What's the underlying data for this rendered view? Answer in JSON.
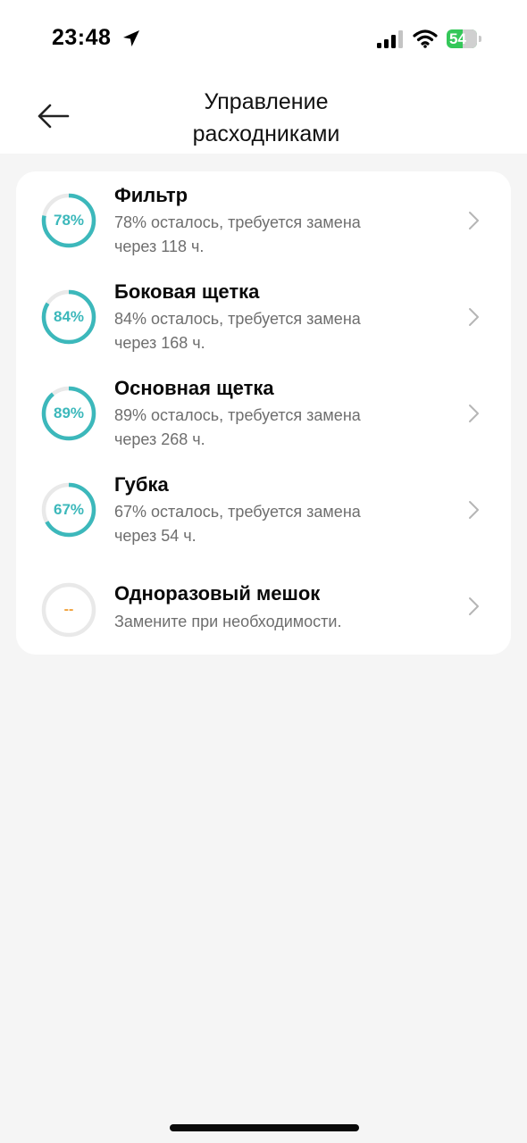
{
  "status_bar": {
    "time": "23:48",
    "battery_text": "54",
    "battery_level": 0.54,
    "location_icon": "location-arrow-icon",
    "signal_icon": "cellular-signal-icon",
    "wifi_icon": "wifi-icon"
  },
  "header": {
    "back_icon": "back-arrow-icon",
    "title": "Управление\nрасходниками"
  },
  "colors": {
    "accent": "#3cb8bb",
    "ring_track": "#e9e9e9",
    "placeholder": "#f0a13a",
    "battery": "#34c759"
  },
  "consumables": [
    {
      "name": "Фильтр",
      "percent_label": "78%",
      "remaining": 0.78,
      "desc_line1": "78% осталось, требуется замена",
      "desc_line2": "через 118 ч."
    },
    {
      "name": "Боковая щетка",
      "percent_label": "84%",
      "remaining": 0.84,
      "desc_line1": "84% осталось, требуется замена",
      "desc_line2": "через 168 ч."
    },
    {
      "name": "Основная щетка",
      "percent_label": "89%",
      "remaining": 0.89,
      "desc_line1": "89% осталось, требуется замена",
      "desc_line2": "через 268 ч."
    },
    {
      "name": "Губка",
      "percent_label": "67%",
      "remaining": 0.67,
      "desc_line1": "67% осталось, требуется замена",
      "desc_line2": "через 54 ч."
    },
    {
      "name": "Одноразовый мешок",
      "percent_label": "--",
      "remaining": 0,
      "desc_line1": "Замените при необходимости.",
      "desc_line2": ""
    }
  ],
  "chevron_icon": "chevron-right-icon"
}
